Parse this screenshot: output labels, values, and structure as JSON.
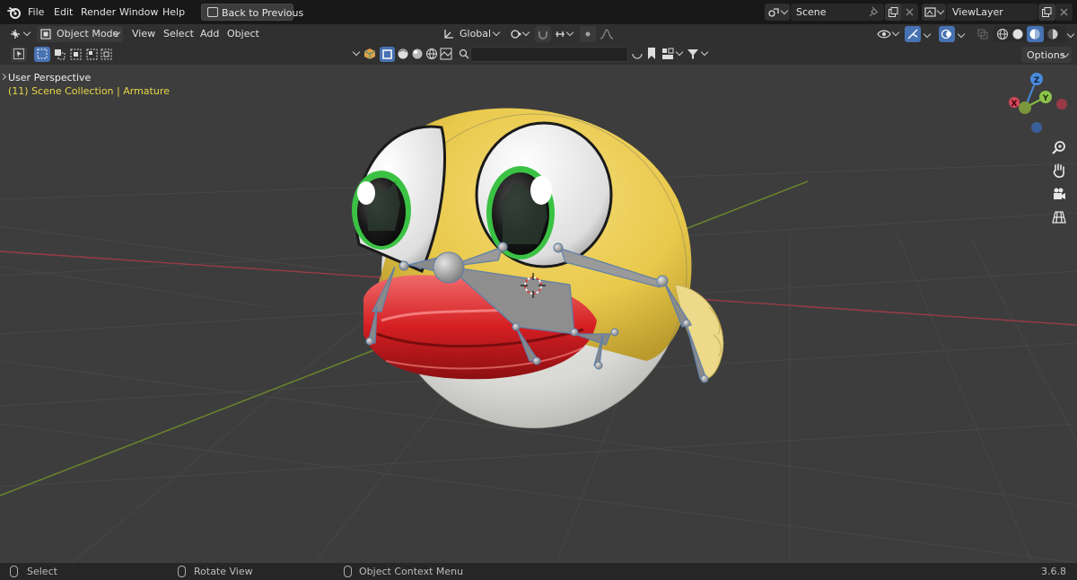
{
  "menu": {
    "items": [
      "File",
      "Edit",
      "Render",
      "Window",
      "Help"
    ],
    "back_button": "Back to Previous"
  },
  "scene": {
    "name": "Scene",
    "view_layer": "ViewLayer"
  },
  "header": {
    "mode": "Object Mode",
    "menus": [
      "View",
      "Select",
      "Add",
      "Object"
    ],
    "transform_orientation": "Global"
  },
  "toolrow": {
    "options_label": "Options",
    "search_placeholder": ""
  },
  "viewport": {
    "title": "User Perspective",
    "collection": "(11) Scene Collection | Armature",
    "gizmo_axes": [
      "X",
      "Y",
      "Z"
    ]
  },
  "status": {
    "select": "Select",
    "rotate": "Rotate View",
    "context_menu": "Object Context Menu",
    "version": "3.6.8"
  },
  "colors": {
    "accent": "#4772b3",
    "axis_x": "#e04a5c",
    "axis_y": "#8bc34a",
    "axis_z": "#4a8bdc",
    "collection_text": "#e7d84a"
  },
  "icons": [
    "blender-logo",
    "back-icon",
    "scene-icon",
    "pin-icon",
    "copy-icon",
    "close-icon",
    "view-layer-icon",
    "editor-type-icon",
    "mode-icon",
    "transform-icon",
    "snap-icon",
    "proportional-icon",
    "select-mode-icons",
    "search-icon",
    "filter-icon",
    "visibility-icon",
    "gizmo-icon",
    "overlay-icon",
    "xray-icon",
    "shading-icons",
    "zoom-icon",
    "hand-icon",
    "camera-icon",
    "grid-icon",
    "mouse-icon"
  ]
}
